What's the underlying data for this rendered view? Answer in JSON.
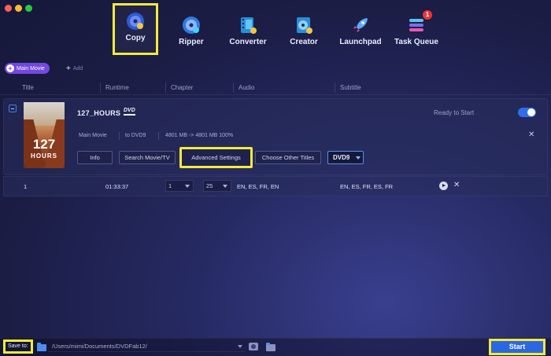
{
  "toolbar": {
    "items": [
      {
        "label": "Copy",
        "icon": "copy-disc-icon",
        "selected": true
      },
      {
        "label": "Ripper",
        "icon": "ripper-disc-icon",
        "selected": false
      },
      {
        "label": "Converter",
        "icon": "converter-film-icon",
        "selected": false
      },
      {
        "label": "Creator",
        "icon": "creator-disc-icon",
        "selected": false
      },
      {
        "label": "Launchpad",
        "icon": "rocket-icon",
        "selected": false
      },
      {
        "label": "Task Queue",
        "icon": "task-queue-icon",
        "selected": false,
        "badge": "1"
      }
    ]
  },
  "mode": {
    "main_movie_label": "Main Movie",
    "add_label": "Add"
  },
  "columns": [
    "Title",
    "Runtime",
    "Chapter",
    "Audio",
    "Subtitle"
  ],
  "title_panel": {
    "title": "127_HOURS",
    "disc_logo": "DVD",
    "poster_title": "127",
    "poster_subtitle": "HOURS",
    "status": "Ready to Start",
    "toggle_on": true,
    "mode": "Main Movie",
    "target": "to DVD9",
    "size_info": "4801 MB -> 4801 MB 100%",
    "buttons": {
      "info": "Info",
      "search": "Search Movie/TV",
      "advanced": "Advanced Settings",
      "choose": "Choose Other Titles"
    },
    "output_select": "DVD9"
  },
  "track": {
    "index": "1",
    "runtime": "01:33:37",
    "chapter_from": "1",
    "chapter_to": "25",
    "audio": "EN, ES, FR, EN",
    "subtitle": "EN, ES, FR, ES, FR"
  },
  "bottom": {
    "save_to_label": "Save to:",
    "path": "/Users/mimi/Documents/DVDFab12/",
    "start_label": "Start"
  },
  "colors": {
    "highlight": "#f4ea3b",
    "accent": "#2a67e3",
    "pill": "#7248e0"
  }
}
